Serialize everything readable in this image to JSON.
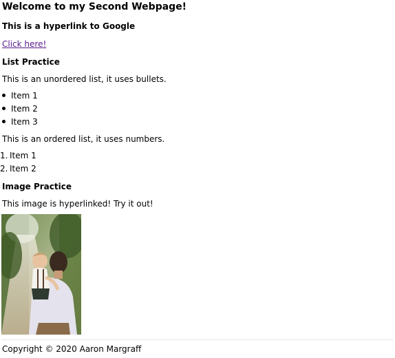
{
  "page": {
    "title": "Welcome to my Second Webpage!",
    "hyperlink_heading": "This is a hyperlink to Google",
    "link_text": "Click here!",
    "list_heading": "List Practice",
    "unordered_desc": "This is an unordered list, it uses bullets.",
    "unordered_items": [
      "Item 1",
      "Item 2",
      "Item 3"
    ],
    "ordered_desc": "This is an ordered list, it uses numbers.",
    "ordered_items": [
      {
        "num": "1.",
        "label": "Item 1"
      },
      {
        "num": "2.",
        "label": "Item 2"
      }
    ],
    "image_heading": "Image Practice",
    "image_desc": "This image is hyperlinked! Try it out!",
    "footer": "Copyright © 2020 Aaron Margraff"
  },
  "colors": {
    "visited_link": "#551a8b",
    "text": "#000000",
    "footer_rule": "#e6e6e6"
  }
}
